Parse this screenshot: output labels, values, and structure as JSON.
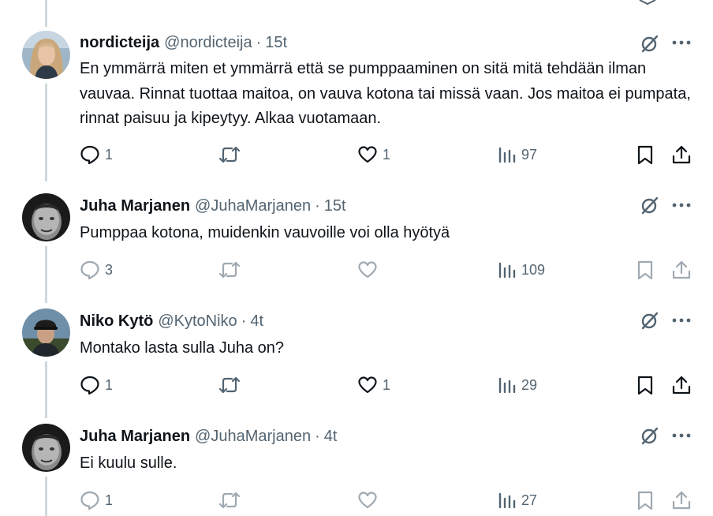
{
  "posts": [
    {
      "name": "nordicteija",
      "handle": "@nordicteija",
      "time": "15t",
      "text": "En ymmärrä miten et ymmärrä että se pumppaaminen on sitä mitä tehdään ilman vauvaa. Rinnat tuottaa maitoa, on vauva kotona tai missä vaan. Jos maitoa ei pumpata, rinnat paisuu ja kipeytyy. Alkaa vuotamaan.",
      "replies": "1",
      "reposts": "",
      "likes": "1",
      "views": "97"
    },
    {
      "name": "Juha Marjanen",
      "handle": "@JuhaMarjanen",
      "time": "15t",
      "text": "Pumppaa kotona, muidenkin vauvoille voi olla hyötyä",
      "replies": "3",
      "reposts": "",
      "likes": "",
      "views": "109"
    },
    {
      "name": "Niko Kytö",
      "handle": "@KytoNiko",
      "time": "4t",
      "text": "Montako lasta sulla Juha on?",
      "replies": "1",
      "reposts": "",
      "likes": "1",
      "views": "29"
    },
    {
      "name": "Juha Marjanen",
      "handle": "@JuhaMarjanen",
      "time": "4t",
      "text": "Ei kuulu sulle.",
      "replies": "1",
      "reposts": "",
      "likes": "",
      "views": "27"
    }
  ],
  "separator": "·",
  "icons": {
    "reply": "reply-icon",
    "repost": "repost-icon",
    "like": "heart-icon",
    "views": "views-icon",
    "bookmark": "bookmark-icon",
    "share": "share-icon",
    "grok": "grok-icon",
    "more": "more-icon"
  },
  "colors": {
    "text": "#0f1419",
    "secondary": "#536471",
    "thread_line": "#cfd9de"
  }
}
